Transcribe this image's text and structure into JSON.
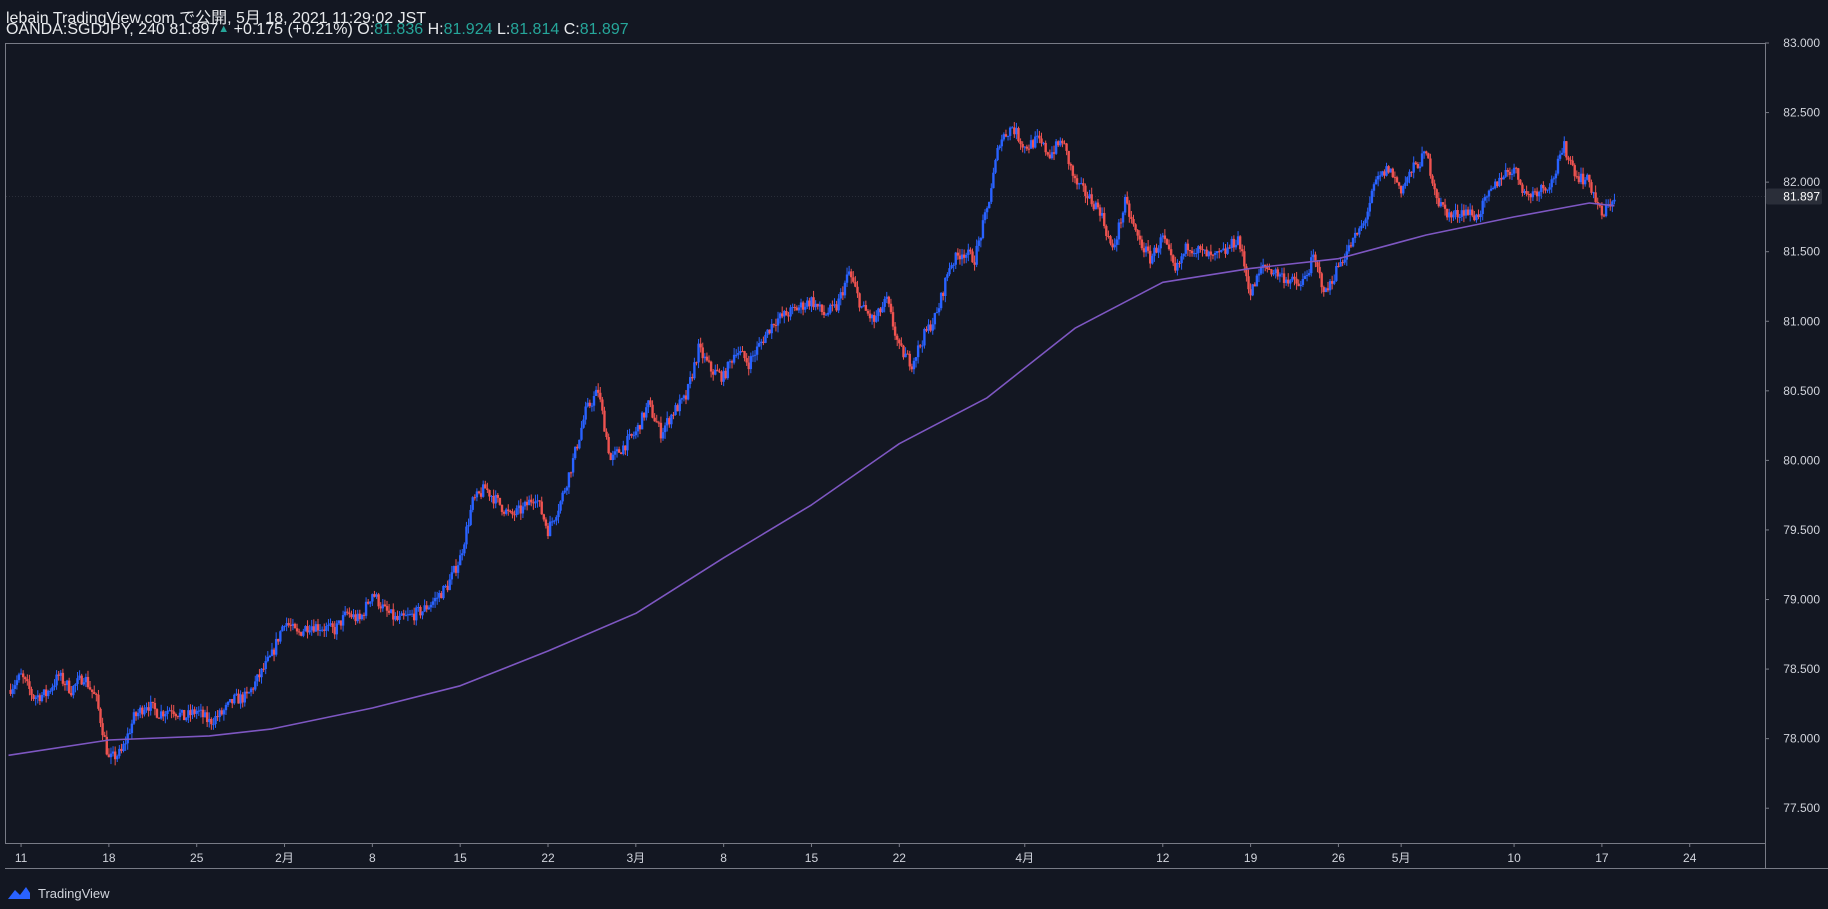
{
  "header": {
    "line1": "lebain TradingView.com で公開, 5月 18, 2021 11:29:02 JST",
    "symbol": "OANDA:SGDJPY, 240",
    "last": "81.897",
    "change": "+0.175 (+0.21%)",
    "o_label": "O:",
    "o_value": "81.836",
    "h_label": "H:",
    "h_value": "81.924",
    "l_label": "L:",
    "l_value": "81.814",
    "c_label": "C:",
    "c_value": "81.897"
  },
  "footer": {
    "brand": "TradingView"
  },
  "colors": {
    "background": "#131722",
    "up": "#2962ff",
    "down": "#ef5350",
    "ma": "#7e57c2",
    "axis_text": "#d1d4dc",
    "axis_line": "#787b86",
    "price_label_bg": "#2a2e39"
  },
  "chart_data": {
    "type": "line",
    "title": "",
    "xlabel": "",
    "ylabel": "",
    "ylim": [
      77.25,
      83.0
    ],
    "price_ticks": [
      "83.000",
      "82.500",
      "82.000",
      "81.500",
      "81.000",
      "80.500",
      "80.000",
      "79.500",
      "79.000",
      "78.500",
      "78.000",
      "77.500"
    ],
    "x_ticks": [
      {
        "label": "11",
        "day": 0
      },
      {
        "label": "18",
        "day": 7
      },
      {
        "label": "25",
        "day": 14
      },
      {
        "label": "2月",
        "day": 21
      },
      {
        "label": "8",
        "day": 28
      },
      {
        "label": "15",
        "day": 35
      },
      {
        "label": "22",
        "day": 42
      },
      {
        "label": "3月",
        "day": 49
      },
      {
        "label": "8",
        "day": 56
      },
      {
        "label": "15",
        "day": 63
      },
      {
        "label": "22",
        "day": 70
      },
      {
        "label": "4月",
        "day": 80
      },
      {
        "label": "12",
        "day": 91
      },
      {
        "label": "19",
        "day": 98
      },
      {
        "label": "26",
        "day": 105
      },
      {
        "label": "5月",
        "day": 110
      },
      {
        "label": "10",
        "day": 119
      },
      {
        "label": "17",
        "day": 126
      },
      {
        "label": "24",
        "day": 133
      }
    ],
    "x_day_range": [
      -1.2,
      139
    ],
    "current_price": {
      "label": "81.897",
      "value": 81.897
    },
    "series": [
      {
        "kind": "candles",
        "points": [
          [
            -1,
            78.35
          ],
          [
            0,
            78.45
          ],
          [
            1,
            78.3
          ],
          [
            2,
            78.32
          ],
          [
            3,
            78.45
          ],
          [
            4,
            78.35
          ],
          [
            5,
            78.45
          ],
          [
            6,
            78.28
          ],
          [
            7,
            77.85
          ],
          [
            8,
            77.9
          ],
          [
            9,
            78.15
          ],
          [
            10,
            78.25
          ],
          [
            11,
            78.18
          ],
          [
            12,
            78.22
          ],
          [
            13,
            78.15
          ],
          [
            14,
            78.2
          ],
          [
            15,
            78.12
          ],
          [
            16,
            78.18
          ],
          [
            17,
            78.28
          ],
          [
            18,
            78.3
          ],
          [
            19,
            78.45
          ],
          [
            20,
            78.6
          ],
          [
            21,
            78.85
          ],
          [
            22,
            78.75
          ],
          [
            23,
            78.82
          ],
          [
            24,
            78.8
          ],
          [
            25,
            78.78
          ],
          [
            26,
            78.9
          ],
          [
            27,
            78.85
          ],
          [
            28,
            79.05
          ],
          [
            29,
            78.92
          ],
          [
            30,
            78.85
          ],
          [
            31,
            78.88
          ],
          [
            32,
            78.92
          ],
          [
            33,
            79.0
          ],
          [
            34,
            79.1
          ],
          [
            35,
            79.3
          ],
          [
            36,
            79.7
          ],
          [
            37,
            79.8
          ],
          [
            38,
            79.7
          ],
          [
            39,
            79.6
          ],
          [
            40,
            79.65
          ],
          [
            41,
            79.75
          ],
          [
            42,
            79.5
          ],
          [
            43,
            79.7
          ],
          [
            44,
            80.0
          ],
          [
            45,
            80.35
          ],
          [
            46,
            80.5
          ],
          [
            47,
            80.0
          ],
          [
            48,
            80.1
          ],
          [
            49,
            80.2
          ],
          [
            50,
            80.4
          ],
          [
            51,
            80.2
          ],
          [
            52,
            80.35
          ],
          [
            53,
            80.45
          ],
          [
            54,
            80.8
          ],
          [
            55,
            80.65
          ],
          [
            56,
            80.6
          ],
          [
            57,
            80.8
          ],
          [
            58,
            80.7
          ],
          [
            59,
            80.85
          ],
          [
            60,
            81.0
          ],
          [
            61,
            81.05
          ],
          [
            62,
            81.1
          ],
          [
            63,
            81.15
          ],
          [
            64,
            81.05
          ],
          [
            65,
            81.1
          ],
          [
            66,
            81.35
          ],
          [
            67,
            81.1
          ],
          [
            68,
            81.0
          ],
          [
            69,
            81.15
          ],
          [
            70,
            80.8
          ],
          [
            71,
            80.7
          ],
          [
            72,
            80.9
          ],
          [
            73,
            81.05
          ],
          [
            74,
            81.4
          ],
          [
            75,
            81.5
          ],
          [
            76,
            81.45
          ],
          [
            77,
            81.8
          ],
          [
            78,
            82.3
          ],
          [
            79,
            82.4
          ],
          [
            80,
            82.25
          ],
          [
            81,
            82.3
          ],
          [
            82,
            82.2
          ],
          [
            83,
            82.3
          ],
          [
            84,
            82.0
          ],
          [
            85,
            81.9
          ],
          [
            86,
            81.8
          ],
          [
            87,
            81.5
          ],
          [
            88,
            81.85
          ],
          [
            89,
            81.6
          ],
          [
            90,
            81.45
          ],
          [
            91,
            81.6
          ],
          [
            92,
            81.35
          ],
          [
            93,
            81.55
          ],
          [
            94,
            81.5
          ],
          [
            95,
            81.45
          ],
          [
            96,
            81.5
          ],
          [
            97,
            81.6
          ],
          [
            98,
            81.2
          ],
          [
            99,
            81.4
          ],
          [
            100,
            81.35
          ],
          [
            101,
            81.3
          ],
          [
            102,
            81.25
          ],
          [
            103,
            81.45
          ],
          [
            104,
            81.2
          ],
          [
            105,
            81.4
          ],
          [
            106,
            81.55
          ],
          [
            107,
            81.7
          ],
          [
            108,
            82.0
          ],
          [
            109,
            82.1
          ],
          [
            110,
            81.95
          ],
          [
            111,
            82.1
          ],
          [
            112,
            82.2
          ],
          [
            113,
            81.85
          ],
          [
            114,
            81.75
          ],
          [
            115,
            81.8
          ],
          [
            116,
            81.75
          ],
          [
            117,
            81.9
          ],
          [
            118,
            82.05
          ],
          [
            119,
            82.1
          ],
          [
            120,
            81.9
          ],
          [
            121,
            81.95
          ],
          [
            122,
            82.0
          ],
          [
            123,
            82.25
          ],
          [
            124,
            82.05
          ],
          [
            125,
            82.0
          ],
          [
            126,
            81.75
          ],
          [
            127,
            81.9
          ]
        ]
      },
      {
        "kind": "moving_average",
        "points": [
          [
            -1,
            77.88
          ],
          [
            7,
            77.99
          ],
          [
            15,
            78.02
          ],
          [
            20,
            78.07
          ],
          [
            28,
            78.22
          ],
          [
            35,
            78.38
          ],
          [
            42,
            78.63
          ],
          [
            49,
            78.9
          ],
          [
            56,
            79.3
          ],
          [
            63,
            79.68
          ],
          [
            70,
            80.12
          ],
          [
            77,
            80.45
          ],
          [
            84,
            80.95
          ],
          [
            91,
            81.28
          ],
          [
            98,
            81.38
          ],
          [
            105,
            81.45
          ],
          [
            112,
            81.62
          ],
          [
            119,
            81.75
          ],
          [
            125,
            81.85
          ],
          [
            127,
            81.83
          ]
        ]
      }
    ]
  }
}
